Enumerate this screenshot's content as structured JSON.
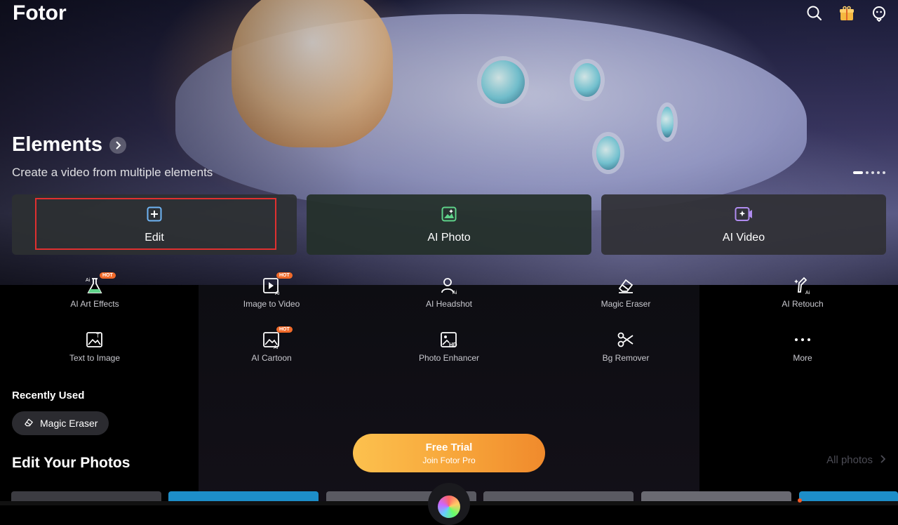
{
  "header": {
    "app_title": "Fotor"
  },
  "hero": {
    "section_title": "Elements",
    "section_subtitle": "Create a video from multiple elements",
    "buttons": [
      {
        "label": "Edit"
      },
      {
        "label": "AI Photo"
      },
      {
        "label": "AI Video"
      }
    ]
  },
  "tools": [
    {
      "label": "AI Art Effects",
      "badge": "HOT",
      "icon": "flask-icon"
    },
    {
      "label": "Image to Video",
      "badge": "HOT",
      "icon": "image-video-icon"
    },
    {
      "label": "AI Headshot",
      "badge": "",
      "icon": "headshot-icon"
    },
    {
      "label": "Magic Eraser",
      "badge": "",
      "icon": "eraser-icon"
    },
    {
      "label": "AI Retouch",
      "badge": "",
      "icon": "retouch-icon"
    },
    {
      "label": "Text to Image",
      "badge": "",
      "icon": "text-image-icon"
    },
    {
      "label": "AI Cartoon",
      "badge": "HOT",
      "icon": "cartoon-icon"
    },
    {
      "label": "Photo Enhancer",
      "badge": "",
      "icon": "hd-image-icon"
    },
    {
      "label": "Bg Remover",
      "badge": "",
      "icon": "scissors-icon"
    },
    {
      "label": "More",
      "badge": "",
      "icon": "more-dots-icon"
    }
  ],
  "recent": {
    "title": "Recently Used",
    "chip_label": "Magic Eraser"
  },
  "edit_section": {
    "title": "Edit Your Photos",
    "all_photos_label": "All photos"
  },
  "promo": {
    "main": "Free Trial",
    "sub": "Join Fotor Pro"
  },
  "colors": {
    "accent_orange": "#f7a53a",
    "hot_badge": "#f06a2a",
    "highlight_red": "#e03030"
  }
}
